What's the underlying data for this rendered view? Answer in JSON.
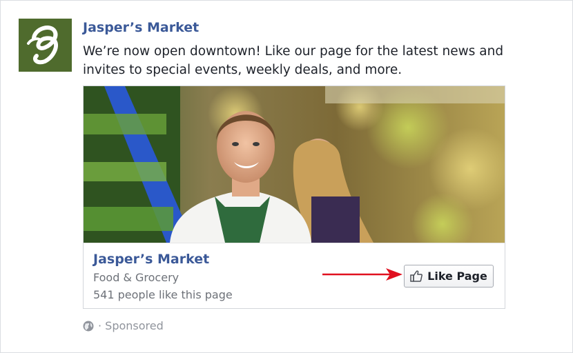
{
  "post": {
    "page_name": "Jasper’s Market",
    "logo_letter": "g",
    "text": "We’re now open downtown! Like our page for the latest news and invites to special events, weekly deals, and more."
  },
  "card": {
    "title": "Jasper’s Market",
    "category": "Food & Grocery",
    "likes": "541 people like this page",
    "like_button_label": "Like Page"
  },
  "footer": {
    "sponsored": "· Sponsored"
  },
  "icons": {
    "logo": "script-g-logo",
    "like": "thumbs-up-icon",
    "globe": "globe-icon",
    "arrow": "red-arrow-icon"
  },
  "colors": {
    "link_blue": "#3b5998",
    "logo_green": "#4f6b2d",
    "arrow_red": "#e0101f",
    "muted_text": "#6d7178"
  }
}
